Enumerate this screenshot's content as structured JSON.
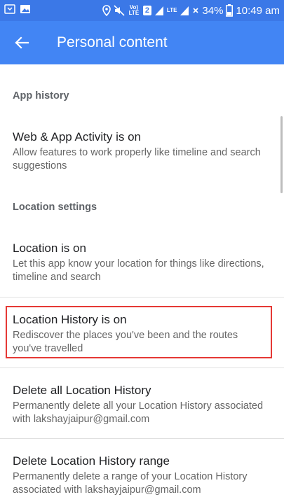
{
  "status_bar": {
    "volte_label": "Vo) LTE",
    "sim_number": "2",
    "lte_label": "LTE",
    "battery_percent": "34%",
    "time": "10:49 am",
    "colors": {
      "background": "#3b78e7"
    }
  },
  "app_bar": {
    "title": "Personal content",
    "back_icon": "arrow-left-icon",
    "colors": {
      "background": "#4285f4",
      "text": "#ffffff"
    }
  },
  "sections": {
    "app_history": {
      "header": "App history",
      "items": [
        {
          "title": "Web & App Activity is on",
          "description": "Allow features to work properly like timeline and search suggestions"
        }
      ]
    },
    "location_settings": {
      "header": "Location settings",
      "items": [
        {
          "title": "Location is on",
          "description": "Let this app know your location for things like directions, timeline and search"
        },
        {
          "title": "Location History is on",
          "description": "Rediscover the places you've been and the routes you've travelled"
        },
        {
          "title": "Delete all Location History",
          "description": "Permanently delete all your Location History associated with lakshayjaipur@gmail.com"
        },
        {
          "title": "Delete Location History range",
          "description": "Permanently delete a range of your Location History associated with lakshayjaipur@gmail.com"
        }
      ]
    }
  },
  "highlight_color": "#e53935"
}
